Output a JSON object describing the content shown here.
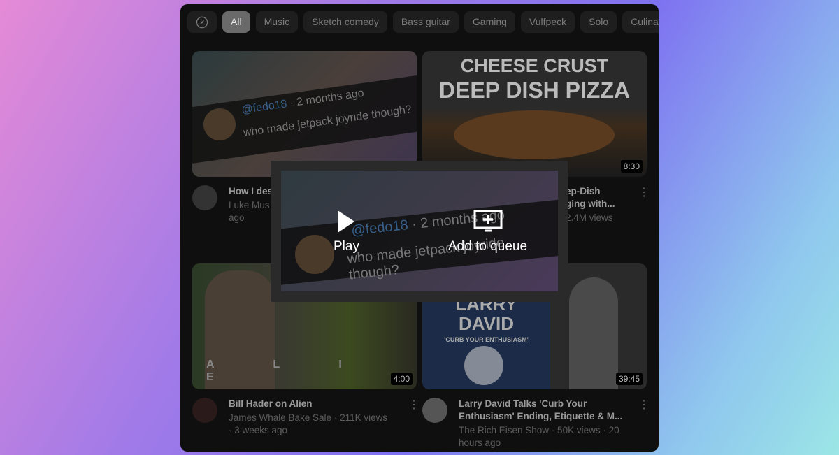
{
  "chips": [
    "All",
    "Music",
    "Sketch comedy",
    "Bass guitar",
    "Gaming",
    "Vulfpeck",
    "Solo",
    "Culinary"
  ],
  "videos": [
    {
      "title": "How I des",
      "channel": "Luke Mus",
      "age": "ago",
      "duration": "",
      "overlay_user": "@fedo18",
      "overlay_time": "2 months ago",
      "overlay_comment": "who made jetpack joyride though?"
    },
    {
      "title": "ep-Dish",
      "title2": "ging with...",
      "stats": "2.4M views",
      "duration": "8:30",
      "thumb_line1": "CHEESE CRUST",
      "thumb_line2": "DEEP DISH PIZZA"
    },
    {
      "title": "Bill Hader on Alien",
      "channel": "James Whale Bake Sale · 211K views",
      "age": "· 3 weeks ago",
      "duration": "4:00",
      "thumb_text": "A L I E"
    },
    {
      "title": "Larry David Talks 'Curb Your Enthusiasm' Ending, Etiquette & M...",
      "channel": "The Rich Eisen Show · 50K views · 20",
      "age": "hours ago",
      "duration": "39:45",
      "thumb_line1": "LARRY",
      "thumb_line2": "DAVID",
      "thumb_line3": "'CURB YOUR ENTHUSIASM'"
    }
  ],
  "modal": {
    "play": "Play",
    "queue": "Add to queue",
    "user": "@fedo18",
    "time": "2 months ago",
    "comment": "who made jetpack joyride though?"
  }
}
